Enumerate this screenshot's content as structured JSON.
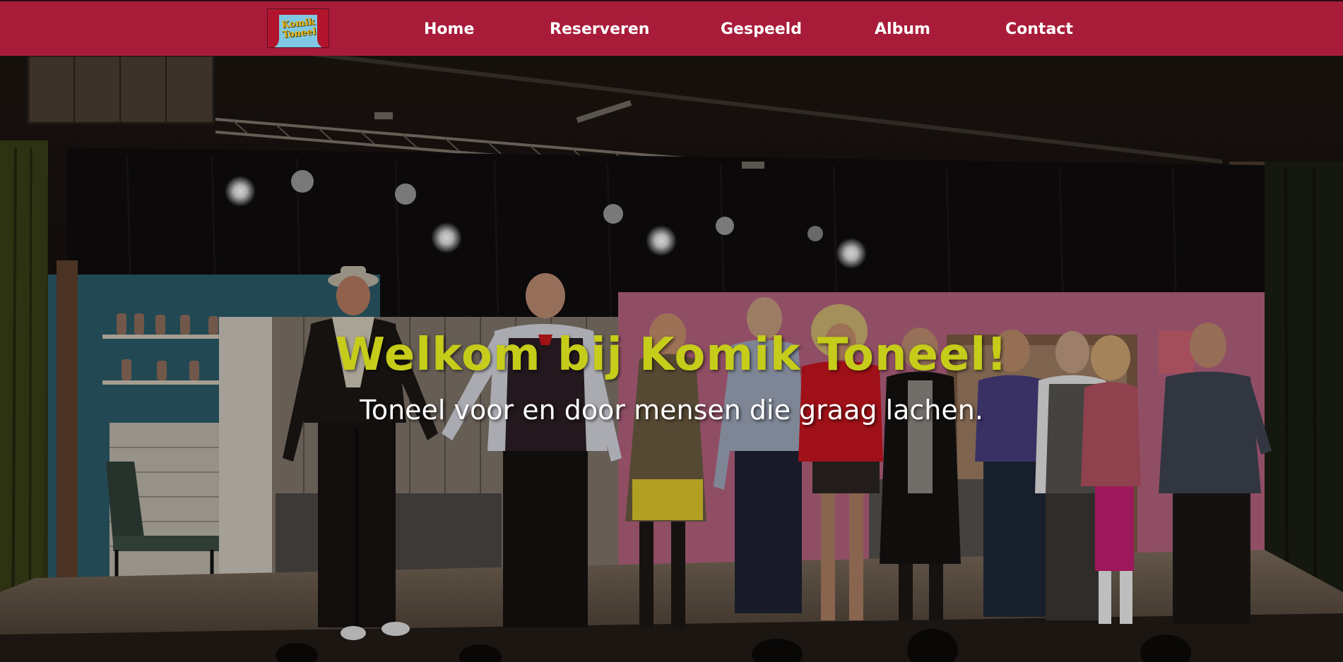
{
  "nav": {
    "logo": {
      "text": "Komik Toneel",
      "icon": "theater-curtain-logo-icon"
    },
    "items": [
      {
        "label": "Home"
      },
      {
        "label": "Reserveren"
      },
      {
        "label": "Gespeeld"
      },
      {
        "label": "Album"
      },
      {
        "label": "Contact"
      }
    ]
  },
  "hero": {
    "title": "Welkom bij Komik Toneel!",
    "subtitle": "Toneel voor en door mensen die graag lachen."
  },
  "colors": {
    "navbar_bg": "#a81c3a",
    "nav_text": "#ffffff",
    "headline": "#c6cc1a",
    "subline": "#ffffff"
  }
}
